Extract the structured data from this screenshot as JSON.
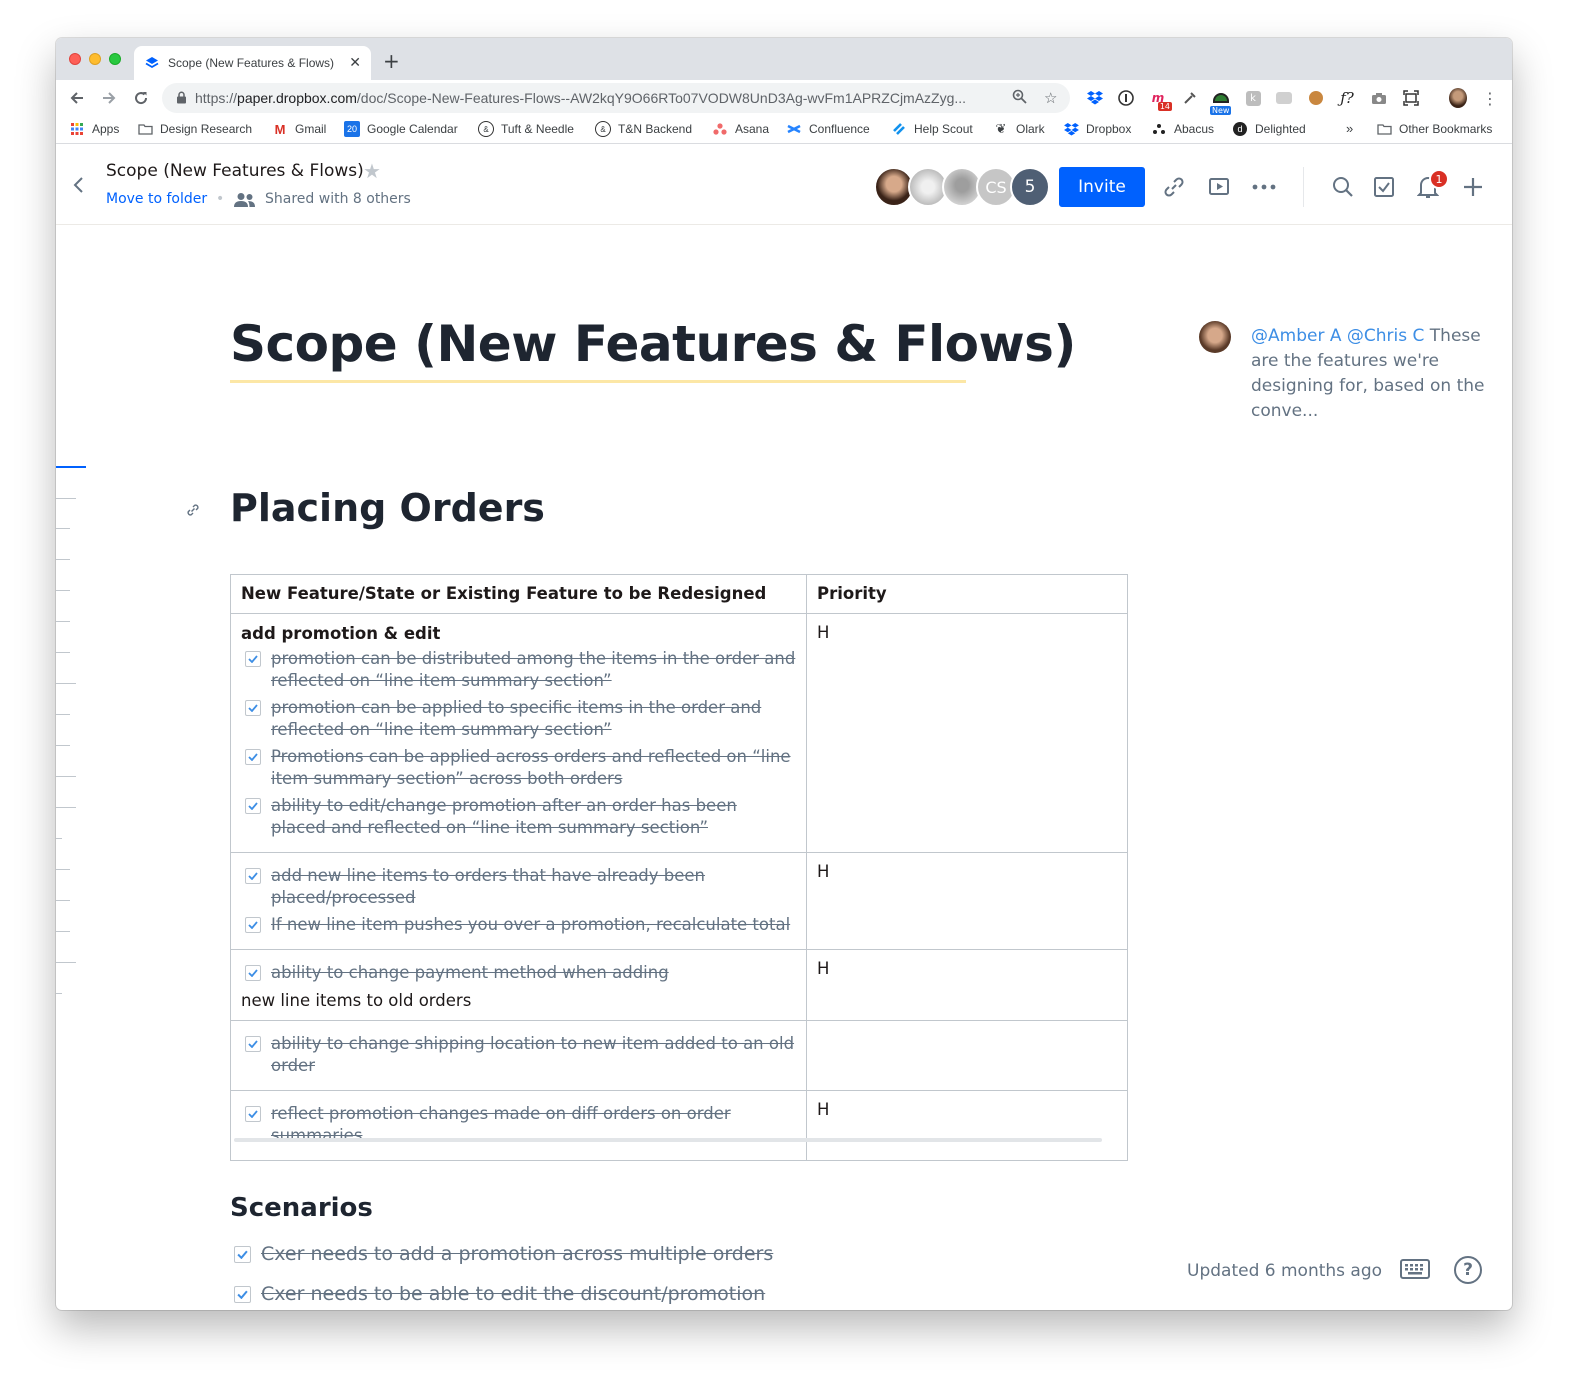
{
  "browser": {
    "tab_title": "Scope (New Features & Flows)",
    "url_prefix": "https://",
    "url_host": "paper.dropbox.com",
    "url_path": "/doc/Scope-New-Features-Flows--AW2kqY9O66RTo07VODW8UnD3Ag-wvFm1APRZCjmAzZyg...",
    "bookmarks": [
      "Apps",
      "Design Research",
      "Gmail",
      "Google Calendar",
      "Tuft & Needle",
      "T&N Backend",
      "Asana",
      "Confluence",
      "Help Scout",
      "Olark",
      "Dropbox",
      "Abacus",
      "Delighted"
    ],
    "more_bookmarks": "»",
    "other_bookmarks": "Other Bookmarks",
    "calendar_day": "20",
    "ext_badge_count": "14",
    "ext_new_label": "New"
  },
  "header": {
    "doc_title": "Scope (New Features & Flows)",
    "move_to_folder": "Move to folder",
    "shared_with": "Shared with 8 others",
    "avatar_initials": "CS",
    "more_count": "5",
    "invite_label": "Invite",
    "notification_count": "1"
  },
  "document": {
    "title": "Scope (New Features & Flows)",
    "section_title": "Placing Orders",
    "table": {
      "headers": [
        "New Feature/State or Existing Feature to be Redesigned",
        "Priority"
      ],
      "rows": [
        {
          "heading": "add promotion & edit",
          "tasks": [
            "promotion can be distributed among the items in the order and reflected on “line item summary section”",
            "promotion can be applied to specific items in the order and reflected on “line item summary section”",
            "Promotions can be applied across orders and reflected on “line item summary section” across both orders",
            "ability to edit/change promotion after an order has been placed and reflected on “line item summary section”"
          ],
          "priority": "H"
        },
        {
          "tasks": [
            "add new line items to orders that have already been placed/processed",
            "If new line item pushes you over a promotion, recalculate total"
          ],
          "priority": "H"
        },
        {
          "tasks": [
            "ability to change payment method when adding"
          ],
          "trailing": "new line items to old orders",
          "priority": "H"
        },
        {
          "tasks": [
            "ability to change shipping location to new item added to an old order"
          ],
          "priority": ""
        },
        {
          "tasks": [
            "reflect promotion changes made on diff orders on order summaries"
          ],
          "priority": "H"
        }
      ]
    },
    "scenarios_title": "Scenarios",
    "scenarios": [
      "Cxer needs to add a promotion across multiple orders",
      "Cxer needs to be able to edit the discount/promotion"
    ]
  },
  "comment": {
    "mention1": "@Amber A",
    "mention2": "@Chris C",
    "text": " These are the features we're designing for, based on the conve..."
  },
  "footer": {
    "updated": "Updated 6 months ago"
  },
  "colors": {
    "accent": "#0061fe",
    "mention": "#3d8ee5",
    "muted_text": "#637282",
    "title_underline": "#fce7a6",
    "checkbox_tick": "#3d8ee5"
  }
}
